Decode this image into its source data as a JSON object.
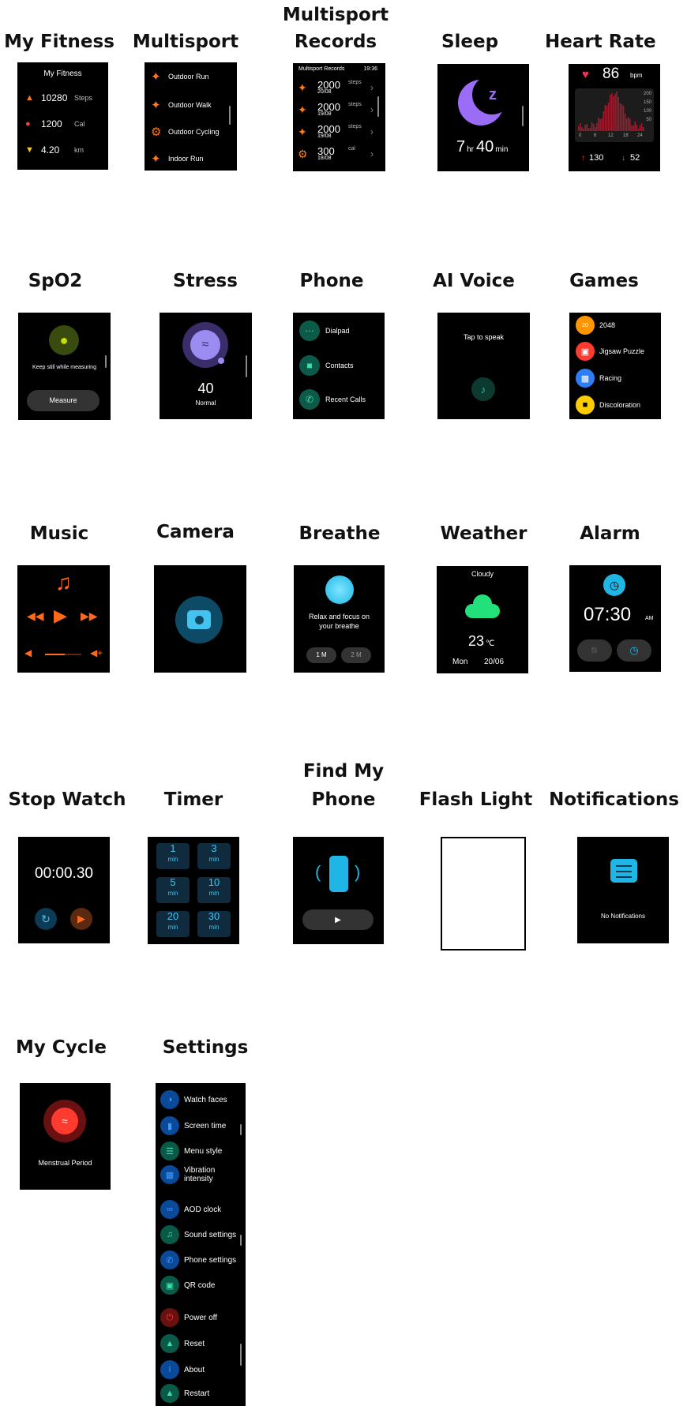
{
  "labels": {
    "my_fitness": "My Fitness",
    "multisport": "Multisport",
    "multisport_records_1": "Multisport",
    "multisport_records_2": "Records",
    "sleep": "Sleep",
    "heart_rate": "Heart Rate",
    "spo2": "SpO2",
    "stress": "Stress",
    "phone": "Phone",
    "ai_voice": "AI Voice",
    "games": "Games",
    "music": "Music",
    "camera": "Camera",
    "breathe": "Breathe",
    "weather": "Weather",
    "alarm": "Alarm",
    "stop_watch": "Stop Watch",
    "timer": "Timer",
    "find_my_phone_1": "Find My",
    "find_my_phone_2": "Phone",
    "flash_light": "Flash Light",
    "notifications": "Notifications",
    "my_cycle": "My Cycle",
    "settings": "Settings"
  },
  "fitness": {
    "title": "My Fitness",
    "rows": [
      {
        "value": "10280",
        "unit": "Steps",
        "icon": "shoe-icon",
        "color": "#ff7a1a"
      },
      {
        "value": "1200",
        "unit": "Cal",
        "icon": "flame-icon",
        "color": "#ff3b30"
      },
      {
        "value": "4.20",
        "unit": "km",
        "icon": "location-pin-icon",
        "color": "#ffcc00"
      }
    ]
  },
  "multisport": {
    "items": [
      "Outdoor Run",
      "Outdoor Walk",
      "Outdoor Cycling",
      "Indoor Run"
    ]
  },
  "records": {
    "title": "Multisport Records",
    "time": "19:36",
    "rows": [
      {
        "value": "2000",
        "unit": "steps",
        "date": "20/08"
      },
      {
        "value": "2000",
        "unit": "steps",
        "date": "19/08"
      },
      {
        "value": "2000",
        "unit": "steps",
        "date": "19/08"
      },
      {
        "value": "300",
        "unit": "cal",
        "date": "18/08"
      }
    ]
  },
  "sleep": {
    "hours": "7",
    "hr_unit": "hr",
    "minutes": "40",
    "min_unit": "min",
    "accent": "#9b6cf6"
  },
  "heart_rate": {
    "bpm": "86",
    "unit": "bpm",
    "y_ticks": [
      "200",
      "150",
      "100",
      "50"
    ],
    "x_ticks": [
      "0",
      "6",
      "12",
      "18",
      "24"
    ],
    "max": "130",
    "min": "52",
    "accent": "#ff2d55"
  },
  "spo2": {
    "message": "Keep still while measuring",
    "button": "Measure"
  },
  "stress": {
    "value": "40",
    "status": "Normal"
  },
  "phone": {
    "items": [
      "Dialpad",
      "Contacts",
      "Recent Calls"
    ]
  },
  "ai_voice": {
    "prompt": "Tap to speak"
  },
  "games": {
    "items": [
      {
        "label": "2048",
        "color": "#ff9500"
      },
      {
        "label": "Jigsaw Puzzle",
        "color": "#ff3b30"
      },
      {
        "label": "Racing",
        "color": "#2d7df6"
      },
      {
        "label": "Discoloration",
        "color": "#ffcc00"
      }
    ]
  },
  "breathe": {
    "message_1": "Relax and focus on",
    "message_2": "your breathe",
    "option_1": "1 M",
    "option_2": "2 M"
  },
  "weather": {
    "condition": "Cloudy",
    "temp": "23",
    "unit": "℃",
    "day": "Mon",
    "date": "20/06"
  },
  "alarm": {
    "time": "07:30",
    "ampm": "AM"
  },
  "stopwatch": {
    "time": "00:00.30"
  },
  "timer": {
    "tiles": [
      {
        "value": "1",
        "unit": "min"
      },
      {
        "value": "3",
        "unit": "min"
      },
      {
        "value": "5",
        "unit": "min"
      },
      {
        "value": "10",
        "unit": "min"
      },
      {
        "value": "20",
        "unit": "min"
      },
      {
        "value": "30",
        "unit": "min"
      }
    ]
  },
  "notifications": {
    "empty": "No Notifications"
  },
  "cycle": {
    "label": "Menstrual Period"
  },
  "settings": {
    "items": [
      "Watch faces",
      "Screen time",
      "Menu style",
      "Vibration",
      "intensity",
      "AOD clock",
      "Sound settings",
      "Phone settings",
      "QR code",
      "Power off",
      "Reset",
      "About",
      "Restart"
    ]
  }
}
